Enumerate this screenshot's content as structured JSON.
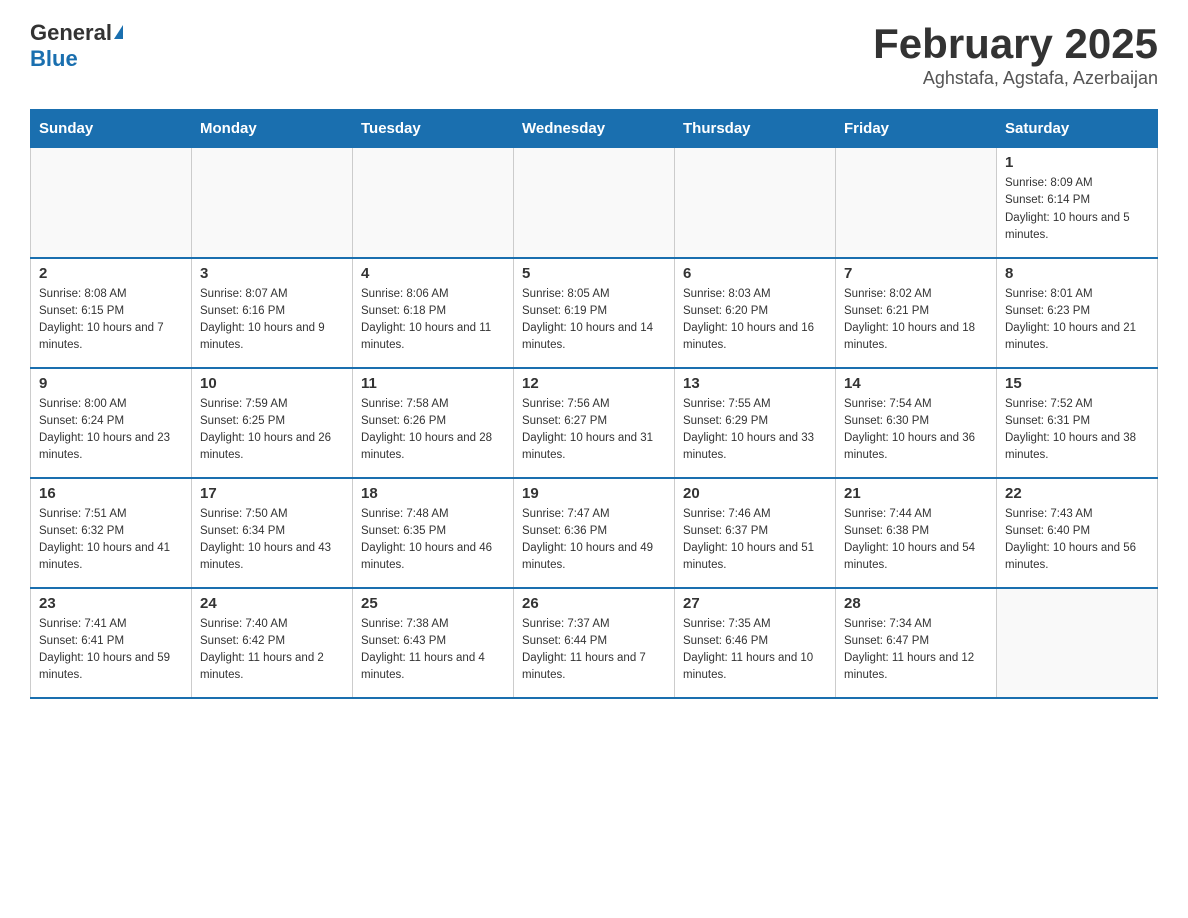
{
  "header": {
    "logo_general": "General",
    "logo_blue": "Blue",
    "title": "February 2025",
    "subtitle": "Aghstafa, Agstafa, Azerbaijan"
  },
  "weekdays": [
    "Sunday",
    "Monday",
    "Tuesday",
    "Wednesday",
    "Thursday",
    "Friday",
    "Saturday"
  ],
  "weeks": [
    [
      {
        "day": "",
        "info": ""
      },
      {
        "day": "",
        "info": ""
      },
      {
        "day": "",
        "info": ""
      },
      {
        "day": "",
        "info": ""
      },
      {
        "day": "",
        "info": ""
      },
      {
        "day": "",
        "info": ""
      },
      {
        "day": "1",
        "info": "Sunrise: 8:09 AM\nSunset: 6:14 PM\nDaylight: 10 hours and 5 minutes."
      }
    ],
    [
      {
        "day": "2",
        "info": "Sunrise: 8:08 AM\nSunset: 6:15 PM\nDaylight: 10 hours and 7 minutes."
      },
      {
        "day": "3",
        "info": "Sunrise: 8:07 AM\nSunset: 6:16 PM\nDaylight: 10 hours and 9 minutes."
      },
      {
        "day": "4",
        "info": "Sunrise: 8:06 AM\nSunset: 6:18 PM\nDaylight: 10 hours and 11 minutes."
      },
      {
        "day": "5",
        "info": "Sunrise: 8:05 AM\nSunset: 6:19 PM\nDaylight: 10 hours and 14 minutes."
      },
      {
        "day": "6",
        "info": "Sunrise: 8:03 AM\nSunset: 6:20 PM\nDaylight: 10 hours and 16 minutes."
      },
      {
        "day": "7",
        "info": "Sunrise: 8:02 AM\nSunset: 6:21 PM\nDaylight: 10 hours and 18 minutes."
      },
      {
        "day": "8",
        "info": "Sunrise: 8:01 AM\nSunset: 6:23 PM\nDaylight: 10 hours and 21 minutes."
      }
    ],
    [
      {
        "day": "9",
        "info": "Sunrise: 8:00 AM\nSunset: 6:24 PM\nDaylight: 10 hours and 23 minutes."
      },
      {
        "day": "10",
        "info": "Sunrise: 7:59 AM\nSunset: 6:25 PM\nDaylight: 10 hours and 26 minutes."
      },
      {
        "day": "11",
        "info": "Sunrise: 7:58 AM\nSunset: 6:26 PM\nDaylight: 10 hours and 28 minutes."
      },
      {
        "day": "12",
        "info": "Sunrise: 7:56 AM\nSunset: 6:27 PM\nDaylight: 10 hours and 31 minutes."
      },
      {
        "day": "13",
        "info": "Sunrise: 7:55 AM\nSunset: 6:29 PM\nDaylight: 10 hours and 33 minutes."
      },
      {
        "day": "14",
        "info": "Sunrise: 7:54 AM\nSunset: 6:30 PM\nDaylight: 10 hours and 36 minutes."
      },
      {
        "day": "15",
        "info": "Sunrise: 7:52 AM\nSunset: 6:31 PM\nDaylight: 10 hours and 38 minutes."
      }
    ],
    [
      {
        "day": "16",
        "info": "Sunrise: 7:51 AM\nSunset: 6:32 PM\nDaylight: 10 hours and 41 minutes."
      },
      {
        "day": "17",
        "info": "Sunrise: 7:50 AM\nSunset: 6:34 PM\nDaylight: 10 hours and 43 minutes."
      },
      {
        "day": "18",
        "info": "Sunrise: 7:48 AM\nSunset: 6:35 PM\nDaylight: 10 hours and 46 minutes."
      },
      {
        "day": "19",
        "info": "Sunrise: 7:47 AM\nSunset: 6:36 PM\nDaylight: 10 hours and 49 minutes."
      },
      {
        "day": "20",
        "info": "Sunrise: 7:46 AM\nSunset: 6:37 PM\nDaylight: 10 hours and 51 minutes."
      },
      {
        "day": "21",
        "info": "Sunrise: 7:44 AM\nSunset: 6:38 PM\nDaylight: 10 hours and 54 minutes."
      },
      {
        "day": "22",
        "info": "Sunrise: 7:43 AM\nSunset: 6:40 PM\nDaylight: 10 hours and 56 minutes."
      }
    ],
    [
      {
        "day": "23",
        "info": "Sunrise: 7:41 AM\nSunset: 6:41 PM\nDaylight: 10 hours and 59 minutes."
      },
      {
        "day": "24",
        "info": "Sunrise: 7:40 AM\nSunset: 6:42 PM\nDaylight: 11 hours and 2 minutes."
      },
      {
        "day": "25",
        "info": "Sunrise: 7:38 AM\nSunset: 6:43 PM\nDaylight: 11 hours and 4 minutes."
      },
      {
        "day": "26",
        "info": "Sunrise: 7:37 AM\nSunset: 6:44 PM\nDaylight: 11 hours and 7 minutes."
      },
      {
        "day": "27",
        "info": "Sunrise: 7:35 AM\nSunset: 6:46 PM\nDaylight: 11 hours and 10 minutes."
      },
      {
        "day": "28",
        "info": "Sunrise: 7:34 AM\nSunset: 6:47 PM\nDaylight: 11 hours and 12 minutes."
      },
      {
        "day": "",
        "info": ""
      }
    ]
  ]
}
